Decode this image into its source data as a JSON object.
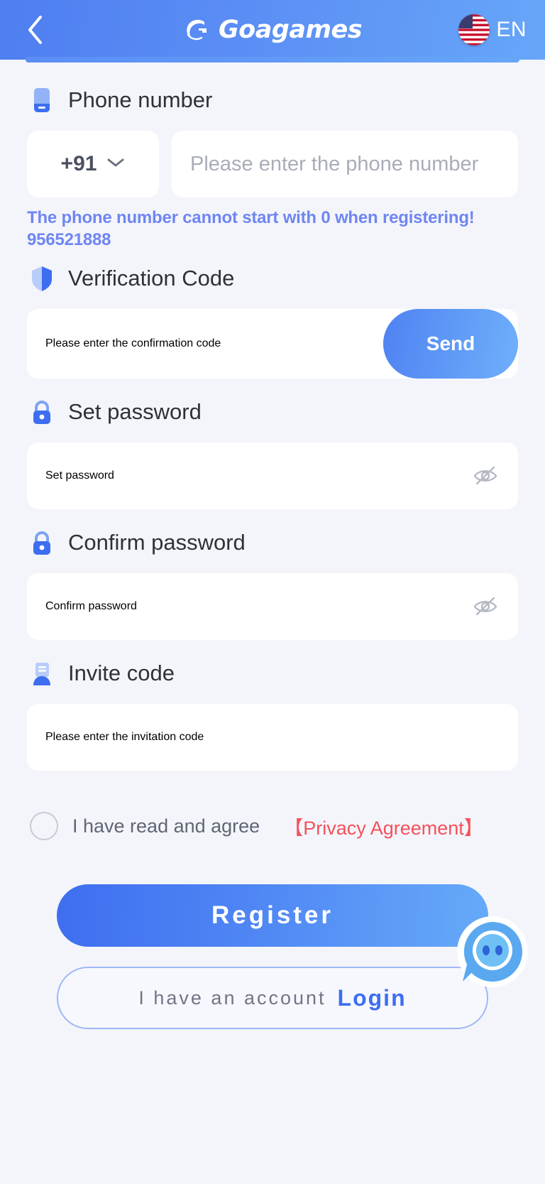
{
  "header": {
    "back_icon": "chevron-left-icon",
    "brand_logo_icon": "goagames-logo-icon",
    "brand_name": "Goagames",
    "flag_icon": "us-flag-icon",
    "language": "EN"
  },
  "form": {
    "phone": {
      "label": "Phone number",
      "label_icon": "phone-icon",
      "country_code": "+91",
      "dropdown_icon": "chevron-down-icon",
      "placeholder": "Please enter the phone number",
      "value": "",
      "hint": "The phone number cannot start with 0 when registering! 956521888"
    },
    "verification": {
      "label": "Verification Code",
      "label_icon": "shield-icon",
      "placeholder": "Please enter the confirmation code",
      "value": "",
      "send_label": "Send"
    },
    "set_password": {
      "label": "Set password",
      "label_icon": "lock-icon",
      "placeholder": "Set password",
      "value": "",
      "toggle_icon": "eye-off-icon"
    },
    "confirm_password": {
      "label": "Confirm password",
      "label_icon": "lock-icon",
      "placeholder": "Confirm password",
      "value": "",
      "toggle_icon": "eye-off-icon"
    },
    "invite_code": {
      "label": "Invite code",
      "label_icon": "invite-card-icon",
      "placeholder": "Please enter the invitation code",
      "value": ""
    }
  },
  "agreement": {
    "checked": false,
    "text": "I have read and agree",
    "link": "【Privacy Agreement】"
  },
  "actions": {
    "register_label": "Register",
    "login_prefix": "I have an account",
    "login_label": "Login"
  },
  "chat": {
    "icon": "chat-support-icon"
  },
  "colors": {
    "header_start": "#4e7ef0",
    "header_end": "#66a6f8",
    "accent": "#4f86f4",
    "hint": "#6f86f2",
    "link_red": "#f4515a",
    "page_bg": "#f4f5fb",
    "field_bg": "#ffffff",
    "placeholder": "#a9adb8"
  }
}
